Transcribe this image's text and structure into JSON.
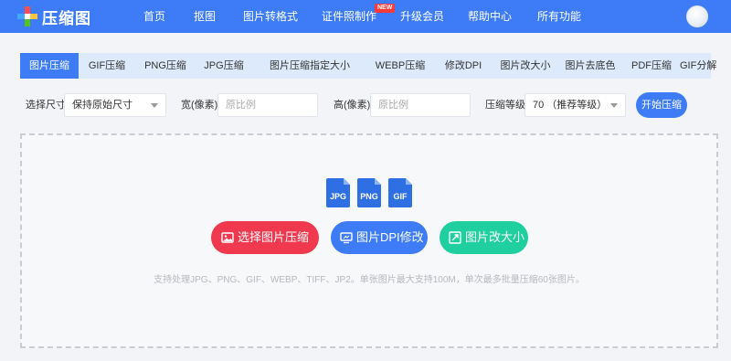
{
  "brand": {
    "name": "压缩图"
  },
  "nav": {
    "items": [
      "首页",
      "抠图",
      "图片转格式",
      "证件照制作",
      "升级会员",
      "帮助中心",
      "所有功能"
    ],
    "new_badge": "NEW"
  },
  "tabs": [
    {
      "label": "图片压缩",
      "active": true
    },
    {
      "label": "GIF压缩"
    },
    {
      "label": "PNG压缩"
    },
    {
      "label": "JPG压缩"
    },
    {
      "label": "图片压缩指定大小"
    },
    {
      "label": "WEBP压缩"
    },
    {
      "label": "修改DPI"
    },
    {
      "label": "图片改大小"
    },
    {
      "label": "图片去底色"
    },
    {
      "label": "PDF压缩"
    },
    {
      "label": "GIF分解"
    }
  ],
  "options": {
    "size_label": "选择尺寸",
    "size_value": "保持原始尺寸",
    "width_label": "宽(像素)",
    "width_placeholder": "原比例",
    "height_label": "高(像素)",
    "height_placeholder": "原比例",
    "level_label": "压缩等级",
    "level_value": "70 （推荐等级）",
    "start_button": "开始压缩"
  },
  "dropzone": {
    "file_types": [
      "JPG",
      "PNG",
      "GIF"
    ],
    "buttons": [
      {
        "label": "选择图片压缩",
        "color": "#f0384f"
      },
      {
        "label": "图片DPI修改",
        "color": "#3d7bf7"
      },
      {
        "label": "图片改大小",
        "color": "#20cfa0"
      }
    ],
    "hint": "支持处理JPG、PNG、GIF、WEBP、TIFF、JP2。单张图片最大支持100M，单次最多批量压缩60张图片。"
  },
  "colors": {
    "primary": "#3d7bf7",
    "tab_bar": "#dceafb",
    "red": "#f0384f",
    "green": "#20cfa0"
  }
}
